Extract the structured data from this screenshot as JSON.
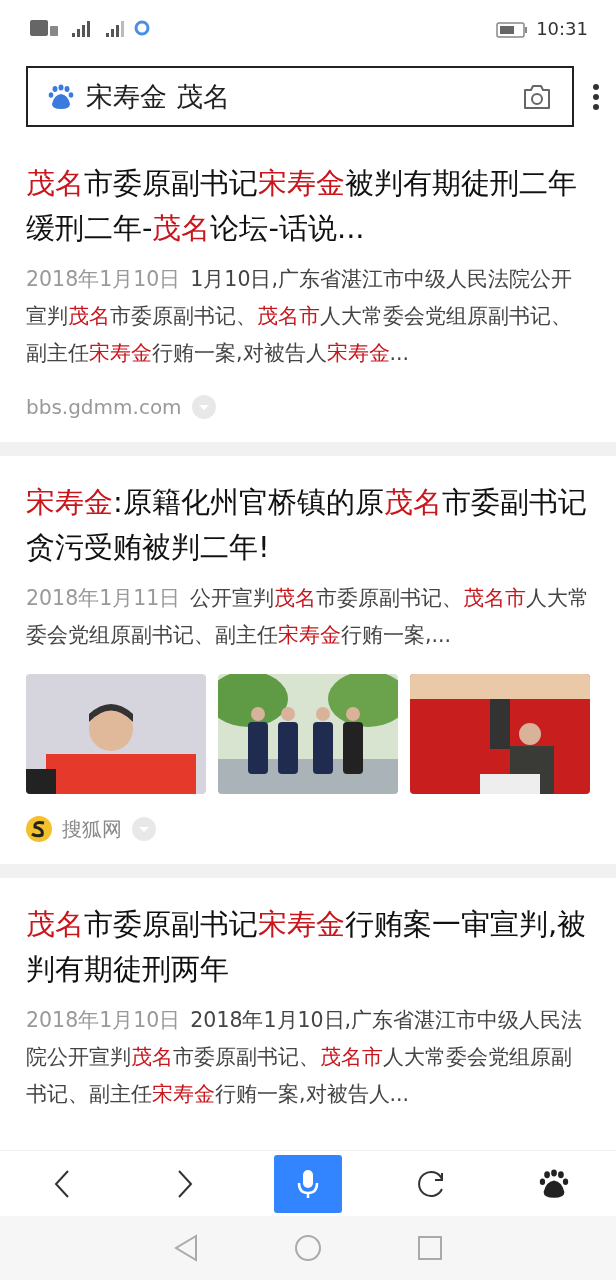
{
  "status_bar": {
    "time": "10:31"
  },
  "search": {
    "value": "宋寿金 茂名"
  },
  "results": [
    {
      "title": [
        {
          "text": "茂名",
          "highlight": true
        },
        {
          "text": "市委原副书记",
          "highlight": false
        },
        {
          "text": "宋寿金",
          "highlight": true
        },
        {
          "text": "被判有期徒刑二年缓刑二年-",
          "highlight": false
        },
        {
          "text": "茂名",
          "highlight": true
        },
        {
          "text": "论坛-话说...",
          "highlight": false
        }
      ],
      "date": "2018年1月10日",
      "snippet": [
        {
          "text": "1月10日,广东省湛江市中级人民法院公开宣判",
          "highlight": false
        },
        {
          "text": "茂名",
          "highlight": true
        },
        {
          "text": "市委原副书记、",
          "highlight": false
        },
        {
          "text": "茂名市",
          "highlight": true
        },
        {
          "text": "人大常委会党组原副书记、副主任",
          "highlight": false
        },
        {
          "text": "宋寿金",
          "highlight": true
        },
        {
          "text": "行贿一案,对被告人",
          "highlight": false
        },
        {
          "text": "宋寿金",
          "highlight": true
        },
        {
          "text": "...",
          "highlight": false
        }
      ],
      "source": {
        "name": "bbs.gdmm.com",
        "kind": "url"
      }
    },
    {
      "title": [
        {
          "text": "宋寿金",
          "highlight": true
        },
        {
          "text": ":原籍化州官桥镇的原",
          "highlight": false
        },
        {
          "text": "茂名",
          "highlight": true
        },
        {
          "text": "市委副书记贪污受贿被判二年!",
          "highlight": false
        }
      ],
      "date": "2018年1月11日",
      "snippet": [
        {
          "text": "公开宣判",
          "highlight": false
        },
        {
          "text": "茂名",
          "highlight": true
        },
        {
          "text": "市委原副书记、",
          "highlight": false
        },
        {
          "text": "茂名市",
          "highlight": true
        },
        {
          "text": "人大常委会党组原副书记、副主任",
          "highlight": false
        },
        {
          "text": "宋寿金",
          "highlight": true
        },
        {
          "text": "行贿一案,...",
          "highlight": false
        }
      ],
      "source": {
        "name": "搜狐网",
        "kind": "site"
      }
    },
    {
      "title": [
        {
          "text": "茂名",
          "highlight": true
        },
        {
          "text": "市委原副书记",
          "highlight": false
        },
        {
          "text": "宋寿金",
          "highlight": true
        },
        {
          "text": "行贿案一审宣判,被判有期徒刑两年",
          "highlight": false
        }
      ],
      "date": "2018年1月10日",
      "snippet": [
        {
          "text": "2018年1月10日,广东省湛江市中级人民法院公开宣判",
          "highlight": false
        },
        {
          "text": "茂名",
          "highlight": true
        },
        {
          "text": "市委原副书记、",
          "highlight": false
        },
        {
          "text": "茂名市",
          "highlight": true
        },
        {
          "text": "人大常委会党组原副书记、副主任",
          "highlight": false
        },
        {
          "text": "宋寿金",
          "highlight": true
        },
        {
          "text": "行贿一案,对被告人...",
          "highlight": false
        }
      ]
    }
  ],
  "toolbar": {
    "voice_active": true
  }
}
